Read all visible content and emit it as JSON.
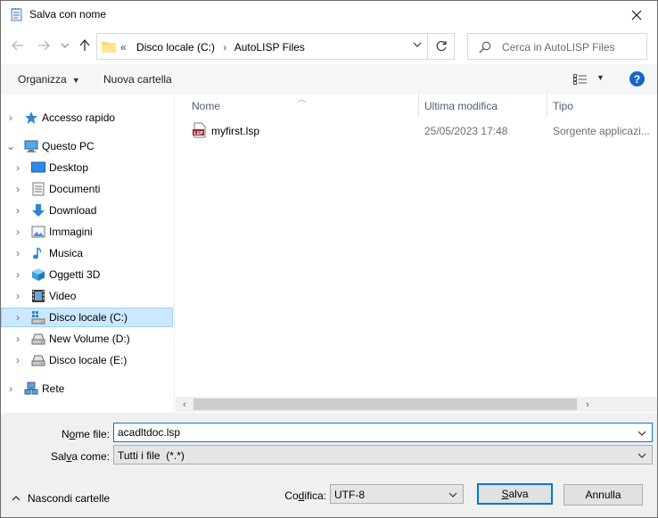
{
  "window": {
    "title": "Salva con nome"
  },
  "address": {
    "overflow": "«",
    "crumbs": [
      "Disco locale (C:)",
      "AutoLISP Files"
    ]
  },
  "search": {
    "placeholder": "Cerca in AutoLISP Files"
  },
  "toolbar": {
    "organize_label": "Organizza",
    "new_folder_label": "Nuova cartella",
    "help_label": "?"
  },
  "nav_tree": {
    "quick_access": "Accesso rapido",
    "this_pc": "Questo PC",
    "desktop": "Desktop",
    "documents": "Documenti",
    "downloads": "Download",
    "pictures": "Immagini",
    "music": "Musica",
    "objects3d": "Oggetti 3D",
    "videos": "Video",
    "drive_c": "Disco locale (C:)",
    "drive_d": "New Volume (D:)",
    "drive_e": "Disco locale (E:)",
    "network": "Rete"
  },
  "file_list": {
    "columns": {
      "name": "Nome",
      "modified": "Ultima modifica",
      "type": "Tipo"
    },
    "files": [
      {
        "name": "myfirst.lsp",
        "modified": "25/05/2023 17:48",
        "type": "Sorgente applicazi..."
      }
    ]
  },
  "form": {
    "filename_label_pre": "N",
    "filename_label_acc": "o",
    "filename_label_post": "me file:",
    "filename_value": "acadltdoc.lsp",
    "savetype_label_pre": "Sal",
    "savetype_label_acc": "v",
    "savetype_label_post": "a come:",
    "savetype_value": "Tutti i file  (*.*)",
    "encoding_label_pre": "Co",
    "encoding_label_acc": "d",
    "encoding_label_post": "ifica:",
    "encoding_value": "UTF-8",
    "save_label_acc": "S",
    "save_label_post": "alva",
    "cancel_label": "Annulla",
    "hide_folders_label": "Nascondi cartelle"
  },
  "colors": {
    "accent": "#0078d7",
    "selection": "#cce8ff",
    "help": "#1467c9"
  }
}
